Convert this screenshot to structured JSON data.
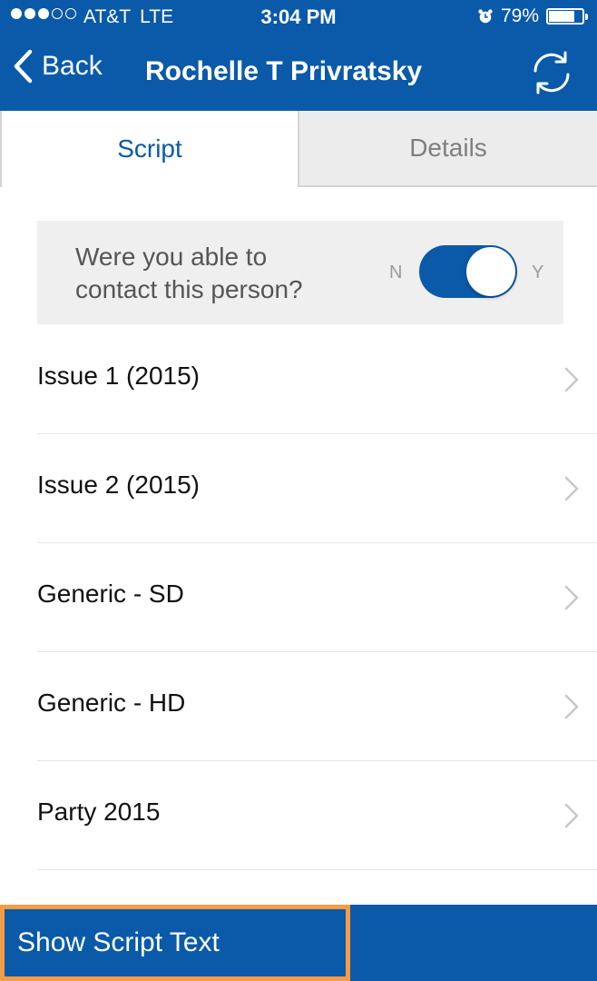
{
  "status_bar": {
    "carrier": "AT&T",
    "network": "LTE",
    "time": "3:04 PM",
    "battery": "79%",
    "battery_level": 0.79,
    "signal_bars": 3,
    "signal_total": 5,
    "icons": [
      "alarm-icon",
      "battery-icon"
    ]
  },
  "nav": {
    "back_label": "Back",
    "title": "Rochelle T Privratsky",
    "icons": [
      "chevron-left-icon",
      "refresh-icon"
    ]
  },
  "tabs": [
    {
      "label": "Script",
      "active": true
    },
    {
      "label": "Details",
      "active": false
    }
  ],
  "contact": {
    "question": "Were you able to contact this person?",
    "toggle_off_label": "N",
    "toggle_on_label": "Y",
    "value": "Y"
  },
  "scripts": [
    {
      "label": "Issue 1 (2015)"
    },
    {
      "label": "Issue 2 (2015)"
    },
    {
      "label": "Generic - SD"
    },
    {
      "label": "Generic - HD"
    },
    {
      "label": "Party 2015"
    }
  ],
  "footer": {
    "show_script_label": "Show Script Text"
  },
  "colors": {
    "brand": "#0a5aa9",
    "highlight": "#f59c45",
    "tab_inactive_bg": "#ececec",
    "card_bg": "#efefef"
  }
}
